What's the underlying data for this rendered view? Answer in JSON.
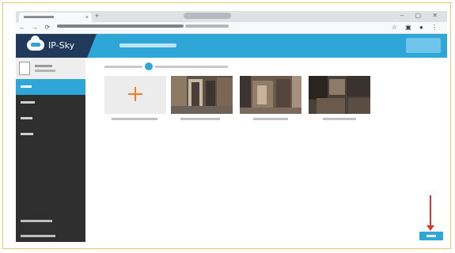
{
  "app": {
    "brand_name": "IP-Sky",
    "accent_color": "#2ea7d8",
    "brand_color": "#1f3a5a"
  },
  "browser": {
    "tab_close": "×",
    "new_tab": "+",
    "window_controls": "‒ ▢ ✕",
    "nav_buttons": "← → ⟳",
    "extensions": "☆ ▣ ● ⋮"
  },
  "sidebar": {
    "items": [
      {
        "icon": "menu-item",
        "active": true
      },
      {
        "icon": "menu-item",
        "active": false
      },
      {
        "icon": "menu-item",
        "active": false
      },
      {
        "icon": "menu-item",
        "active": false
      }
    ],
    "footer_items": [
      {
        "icon": "menu-item"
      },
      {
        "icon": "menu-item"
      }
    ]
  },
  "main": {
    "add_card": {
      "icon": "plus-icon",
      "color": "#f07d23"
    },
    "thumbnails": [
      {
        "icon": "photo-thumbnail"
      },
      {
        "icon": "photo-thumbnail"
      },
      {
        "icon": "photo-thumbnail"
      }
    ],
    "submit": {
      "color": "#2ea7d8"
    },
    "annotation": {
      "icon": "arrow-down-icon",
      "color": "#d9362b"
    }
  }
}
